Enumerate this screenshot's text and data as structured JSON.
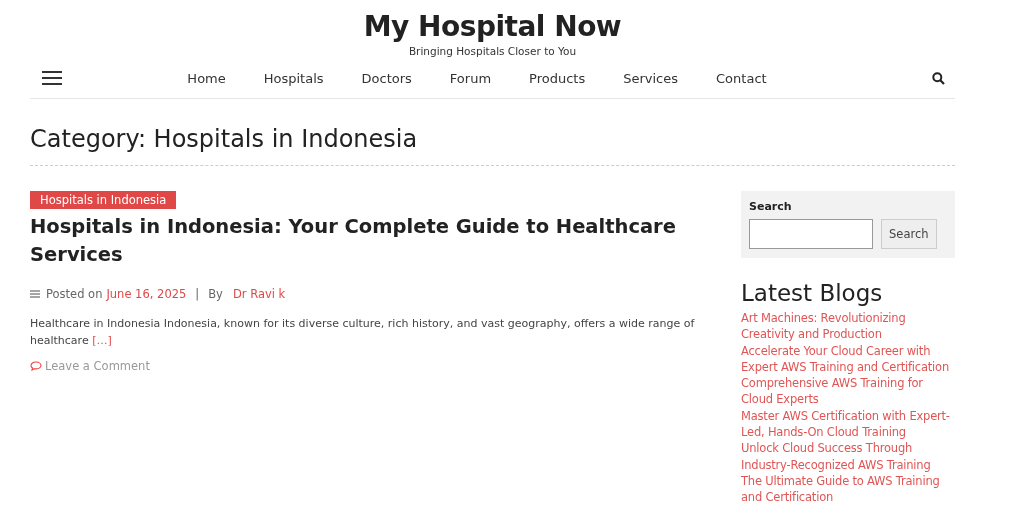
{
  "site": {
    "title": "My Hospital Now",
    "tagline": "Bringing Hospitals Closer to You"
  },
  "nav": {
    "items": [
      {
        "label": "Home"
      },
      {
        "label": "Hospitals"
      },
      {
        "label": "Doctors"
      },
      {
        "label": "Forum"
      },
      {
        "label": "Products"
      },
      {
        "label": "Services"
      },
      {
        "label": "Contact"
      }
    ]
  },
  "page_title": "Category: Hospitals in Indonesia",
  "post": {
    "category": "Hospitals in Indonesia",
    "title": "Hospitals in Indonesia: Your Complete Guide to Healthcare Services",
    "posted_on": "Posted on",
    "date": "June 16, 2025",
    "separator": "|",
    "by": "By",
    "author": "Dr Ravi k",
    "excerpt": "Healthcare in Indonesia Indonesia, known for its diverse culture, rich history, and vast geography, offers a wide range of healthcare",
    "more": "[…]",
    "comment": "Leave a Comment"
  },
  "sidebar": {
    "search": {
      "label": "Search",
      "button": "Search"
    },
    "latest_title": "Latest Blogs",
    "latest": [
      "Art Machines: Revolutionizing Creativity and Production",
      "Accelerate Your Cloud Career with Expert AWS Training and Certification",
      "Comprehensive AWS Training for Cloud Experts",
      "Master AWS Certification with Expert-Led, Hands-On Cloud Training",
      "Unlock Cloud Success Through Industry-Recognized AWS Training",
      "The Ultimate Guide to AWS Training and Certification"
    ]
  }
}
